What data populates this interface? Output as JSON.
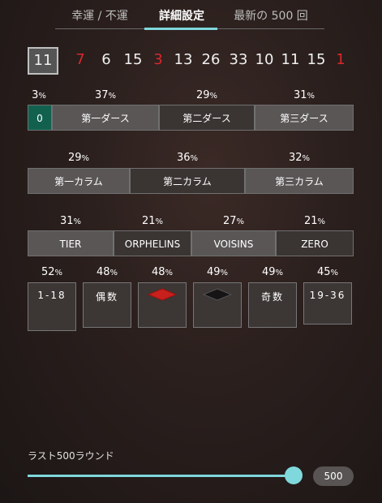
{
  "tabs": [
    {
      "label": "幸運 / 不運"
    },
    {
      "label": "詳細設定"
    },
    {
      "label": "最新の 500 回"
    }
  ],
  "recent_numbers": [
    {
      "value": "11",
      "color": "#f0f0f0"
    },
    {
      "value": "7",
      "color": "#d8282a"
    },
    {
      "value": "6",
      "color": "#f0f0f0"
    },
    {
      "value": "15",
      "color": "#f0f0f0"
    },
    {
      "value": "3",
      "color": "#d8282a"
    },
    {
      "value": "13",
      "color": "#f0f0f0"
    },
    {
      "value": "26",
      "color": "#f0f0f0"
    },
    {
      "value": "33",
      "color": "#f0f0f0"
    },
    {
      "value": "10",
      "color": "#f0f0f0"
    },
    {
      "value": "11",
      "color": "#f0f0f0"
    },
    {
      "value": "15",
      "color": "#f0f0f0"
    },
    {
      "value": "1",
      "color": "#d8282a"
    }
  ],
  "dozens": {
    "zero": {
      "pct": "3",
      "label": "0"
    },
    "items": [
      {
        "pct": "37",
        "label": "第一ダース"
      },
      {
        "pct": "29",
        "label": "第二ダース"
      },
      {
        "pct": "31",
        "label": "第三ダース"
      }
    ]
  },
  "columns": [
    {
      "pct": "29",
      "label": "第一カラム"
    },
    {
      "pct": "36",
      "label": "第二カラム"
    },
    {
      "pct": "32",
      "label": "第三カラム"
    }
  ],
  "sectors": [
    {
      "pct": "31",
      "label": "TIER"
    },
    {
      "pct": "21",
      "label": "ORPHELINS"
    },
    {
      "pct": "27",
      "label": "VOISINS"
    },
    {
      "pct": "21",
      "label": "ZERO"
    }
  ],
  "even_money": [
    {
      "pct": "52",
      "label": "1-18"
    },
    {
      "pct": "48",
      "label": "偶数"
    },
    {
      "pct": "48",
      "label": "",
      "icon": "red-diamond-icon"
    },
    {
      "pct": "49",
      "label": "",
      "icon": "black-diamond-icon"
    },
    {
      "pct": "49",
      "label": "奇数"
    },
    {
      "pct": "45",
      "label": "19-36"
    }
  ],
  "pct_suffix": "%",
  "slider": {
    "label": "ラスト500ラウンド",
    "value": "500",
    "fraction": 1.0
  },
  "colors": {
    "accent": "#7fd8dc",
    "red": "#d8282a",
    "green": "#12614f"
  }
}
